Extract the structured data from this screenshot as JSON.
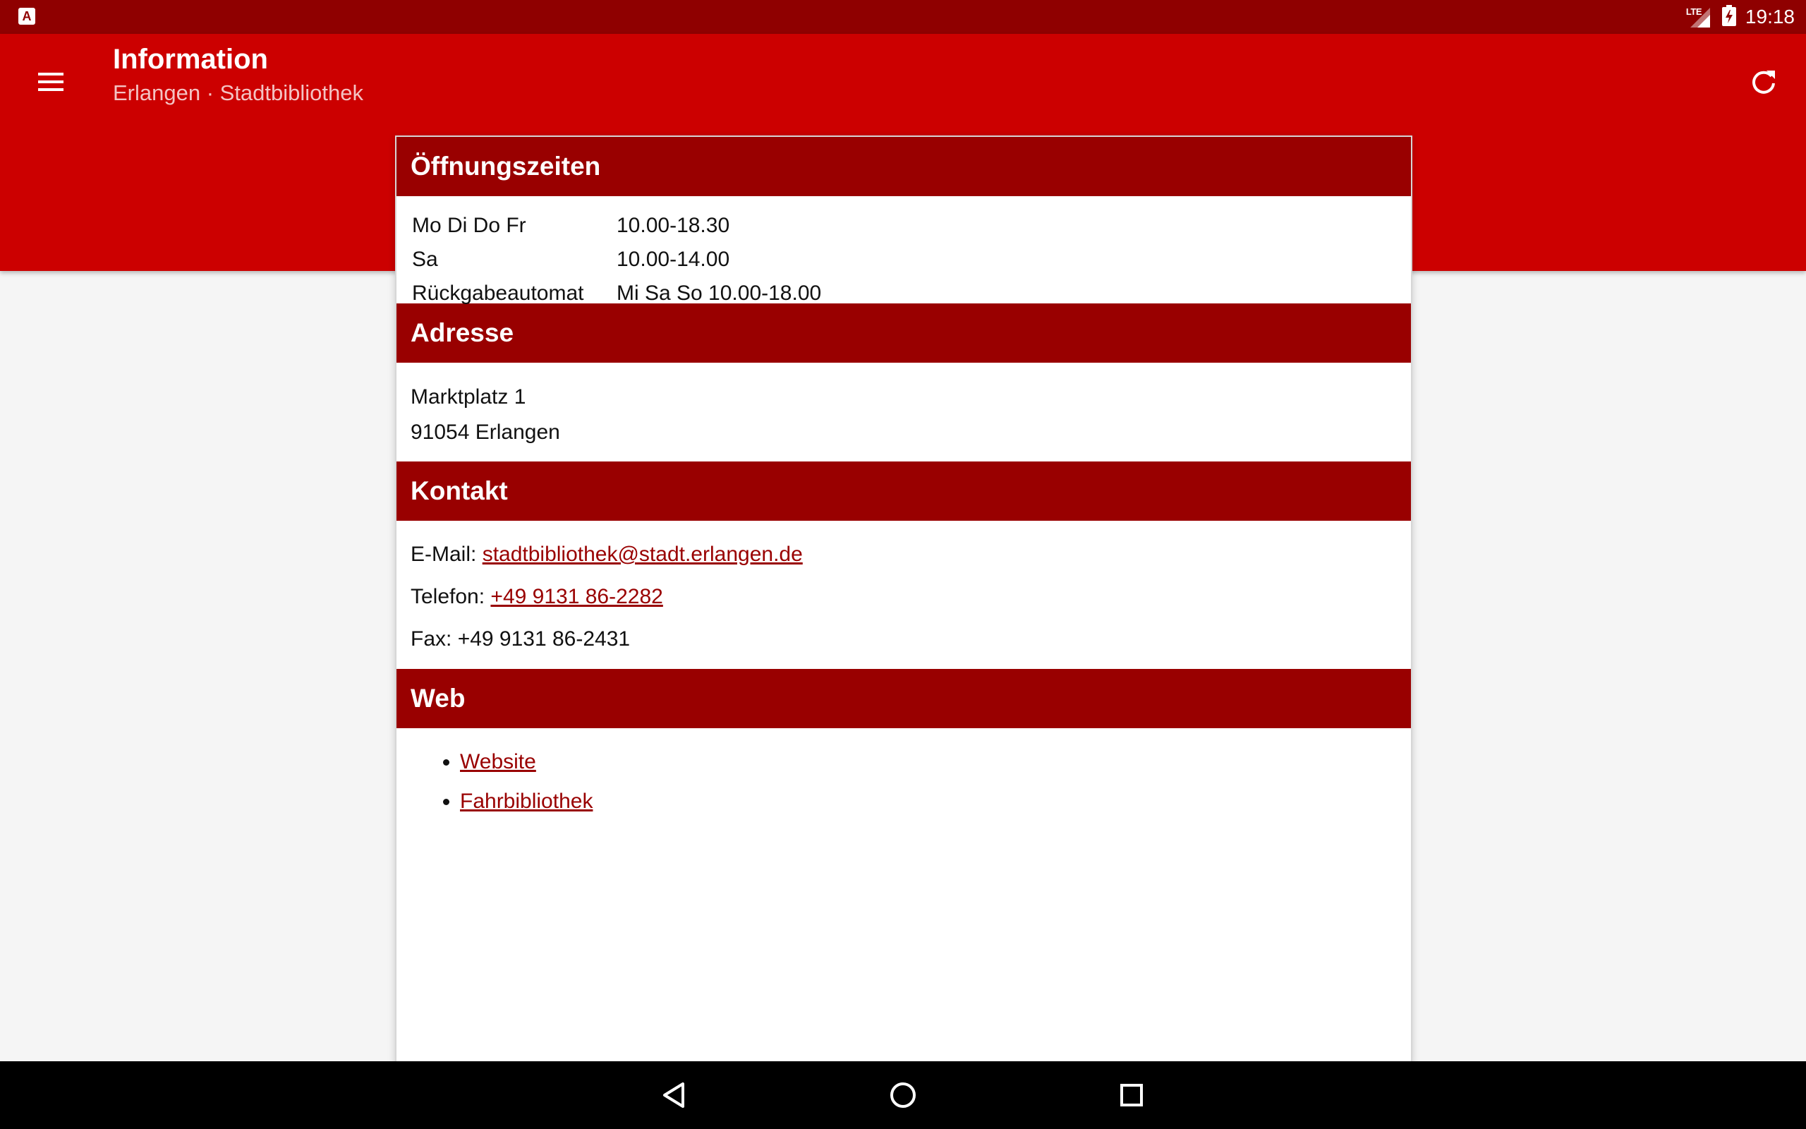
{
  "status_bar": {
    "network": "LTE",
    "time": "19:18",
    "colors": {
      "background": "#8f0000"
    },
    "icons": [
      "app-notification-icon",
      "lte-signal-icon",
      "battery-charging-icon"
    ]
  },
  "app_bar": {
    "title": "Information",
    "subtitle": "Erlangen · Stadtbibliothek",
    "colors": {
      "background": "#cc0000"
    },
    "icons": [
      "menu-icon",
      "refresh-icon"
    ]
  },
  "sections": {
    "hours": {
      "title": "Öffnungszeiten",
      "rows": [
        {
          "day": "Mo Di Do Fr",
          "time": "10.00-18.30"
        },
        {
          "day": "Sa",
          "time": "10.00-14.00"
        },
        {
          "day": "Rückgabeautomat",
          "time": "Mi Sa So 10.00-18.00"
        }
      ]
    },
    "address": {
      "title": "Adresse",
      "street": "Marktplatz 1",
      "city": "91054 Erlangen"
    },
    "contact": {
      "title": "Kontakt",
      "email_label": "E-Mail: ",
      "email": "stadtbibliothek@stadt.erlangen.de",
      "phone_label": "Telefon: ",
      "phone": "+49 9131 86-2282",
      "fax_label": "Fax: ",
      "fax": "+49 9131 86-2431"
    },
    "web": {
      "title": "Web",
      "links": [
        "Website",
        "Fahrbibliothek"
      ]
    }
  },
  "colors": {
    "section_header": "#990000",
    "link": "#990000",
    "page_background": "#f5f5f5"
  },
  "nav_bar": {
    "icons": [
      "back-icon",
      "home-icon",
      "recents-icon"
    ]
  }
}
